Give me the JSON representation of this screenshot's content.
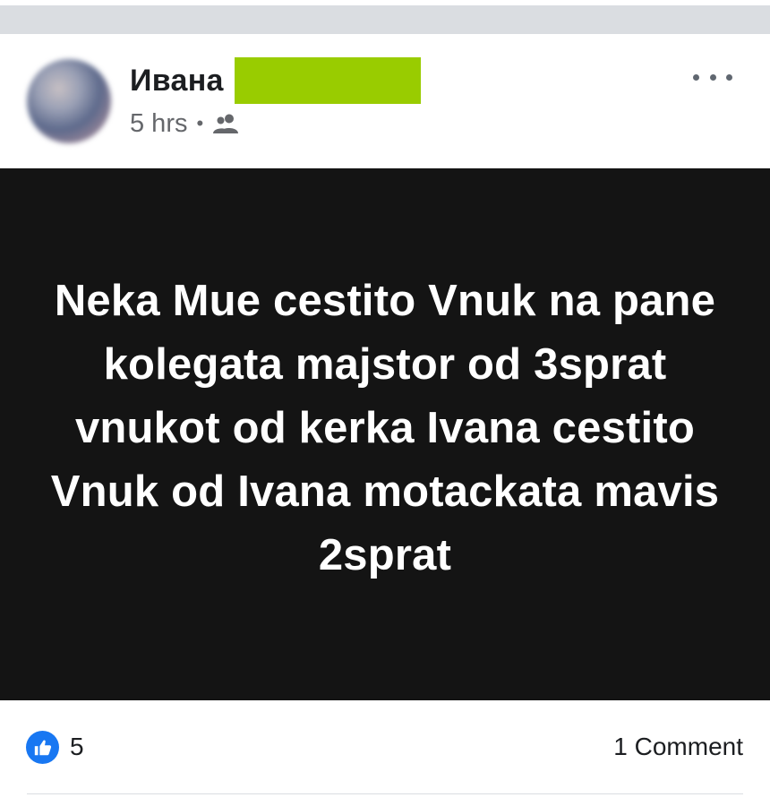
{
  "post": {
    "author_name": "Ивана",
    "timestamp": "5 hrs",
    "separator": "•",
    "audience_icon": "friends-icon",
    "more_icon": "more-options-icon",
    "body_text": "Neka Mue cestito Vnuk na pane kolegata majstor od 3sprat vnukot od kerka Ivana cestito Vnuk od Ivana motackata mavis 2sprat",
    "body_background": "#141414",
    "body_text_color": "#ffffff",
    "redaction_color": "#99cc00"
  },
  "reactions": {
    "icon": "like-icon",
    "like_color": "#1877f2",
    "like_count": "5",
    "comments_label": "1 Comment"
  }
}
